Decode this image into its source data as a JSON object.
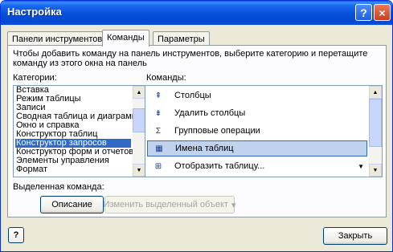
{
  "window": {
    "title": "Настройка",
    "help_button": "?",
    "close_button": "×"
  },
  "tabs": [
    {
      "label": "Панели инструментов",
      "active": false
    },
    {
      "label": "Команды",
      "active": true
    },
    {
      "label": "Параметры",
      "active": false
    }
  ],
  "panel": {
    "instruction_line1": "Чтобы добавить команду на панель инструментов, выберите категорию и перетащите",
    "instruction_line2": "команду из этого окна на панель",
    "categories_label": "Категории:",
    "commands_label": "Команды:",
    "categories": [
      "Вставка",
      "Режим таблицы",
      "Записи",
      "Сводная таблица и диаграмма",
      "Окно и справка",
      "Конструктор таблиц",
      "Конструктор запросов",
      "Конструктор форм и отчетов",
      "Элементы управления",
      "Формат"
    ],
    "selected_category": "Конструктор запросов",
    "commands": [
      {
        "icon": "insert-columns-icon",
        "glyph": "⇞",
        "label": "Столбцы",
        "has_menu": false,
        "selected": false
      },
      {
        "icon": "delete-columns-icon",
        "glyph": "⇟",
        "label": "Удалить столбцы",
        "has_menu": false,
        "selected": false
      },
      {
        "icon": "sigma-icon",
        "glyph": "Σ",
        "label": "Групповые операции",
        "has_menu": false,
        "selected": false
      },
      {
        "icon": "table-names-icon",
        "glyph": "▦",
        "label": "Имена таблиц",
        "has_menu": false,
        "selected": true
      },
      {
        "icon": "show-table-icon",
        "glyph": "⊞",
        "label": "Отобразить таблицу...",
        "has_menu": true,
        "selected": false
      }
    ],
    "selected_command_label": "Выделенная команда:",
    "description_button": "Описание",
    "modify_selection_button": "Изменить выделенный объект",
    "modify_arrow": "▾"
  },
  "footer": {
    "help_icon_glyph": "?",
    "close_button": "Закрыть"
  },
  "colors": {
    "titlebar": "#0653dd",
    "selection": "#316ac5",
    "command_highlight": "#c1d2ee",
    "dialog_bg": "#ece9d8"
  }
}
